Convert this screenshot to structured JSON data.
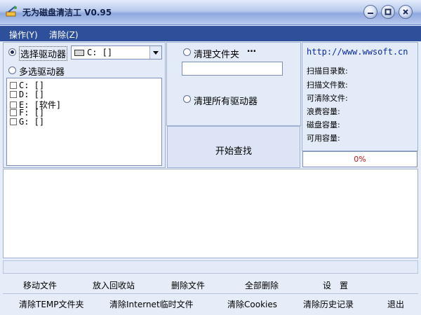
{
  "window": {
    "title": "无为磁盘清洁工 V0.95"
  },
  "menu": {
    "items": [
      "操作(Y)",
      "清除(Z)"
    ]
  },
  "drive_select": {
    "single_label": "选择驱动器",
    "single_value": "C: []",
    "multi_label": "多选驱动器",
    "drives": [
      "C: []",
      "D: []",
      "E: [软件]",
      "F: []",
      "G: []"
    ]
  },
  "folder": {
    "clean_folder_label": "清理文件夹",
    "browse_label": "…",
    "folder_value": "",
    "clean_all_label": "清理所有驱动器",
    "start_button": "开始查找"
  },
  "info": {
    "url": "http://www.wwsoft.cn",
    "stats": [
      "扫描目录数:",
      "扫描文件数:",
      "可清除文件:",
      "浪费容量:",
      "磁盘容量:",
      "可用容量:"
    ],
    "progress_text": "0%"
  },
  "actions_row1": [
    "移动文件",
    "放入回收站",
    "删除文件",
    "全部删除",
    "设　置"
  ],
  "actions_row2": [
    "清除TEMP文件夹",
    "清除Internet临时文件",
    "清除Cookies",
    "清除历史记录",
    "退出"
  ],
  "colors": {
    "menubar": "#2e4f9a",
    "progress_text": "#d01010",
    "url": "#0a2aa0"
  }
}
